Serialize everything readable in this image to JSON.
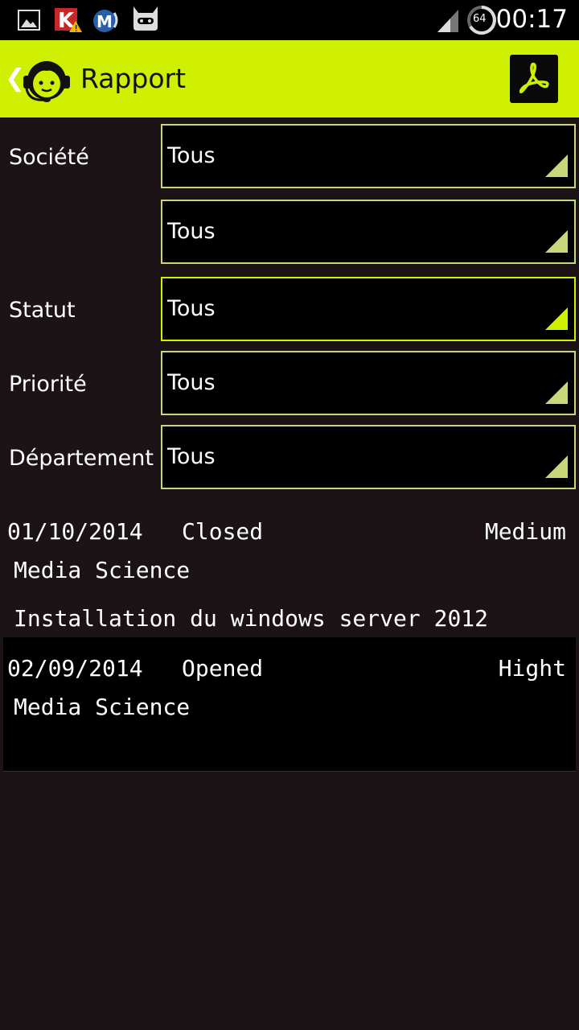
{
  "status_bar": {
    "time": "00:17",
    "battery_level": "64",
    "icons": [
      "image-notification-icon",
      "kaspersky-warning-icon",
      "malwarebytes-icon",
      "cyanogenmod-icon",
      "signal-icon",
      "battery-icon"
    ]
  },
  "action_bar": {
    "title": "Rapport",
    "back_symbol": "❮",
    "logo_icon": "headset-support-icon",
    "pdf_icon": "pdf-icon"
  },
  "filters": [
    {
      "label": "Société",
      "value": "Tous"
    },
    {
      "label": "",
      "value": "Tous"
    },
    {
      "label": "Statut",
      "value": "Tous"
    },
    {
      "label": "Priorité",
      "value": "Tous"
    },
    {
      "label": "Département",
      "value": "Tous"
    }
  ],
  "tickets": [
    {
      "date": "01/10/2014",
      "status": "Closed",
      "priority": "Medium",
      "company": "Media Science",
      "subject": "Installation du windows server 2012"
    },
    {
      "date": "02/09/2014",
      "status": "Opened",
      "priority": "Hight",
      "company": "Media Science",
      "subject": ""
    }
  ],
  "colors": {
    "accent": "#cff000",
    "background": "#1b1316",
    "spinner_border": "#c9d77a"
  }
}
